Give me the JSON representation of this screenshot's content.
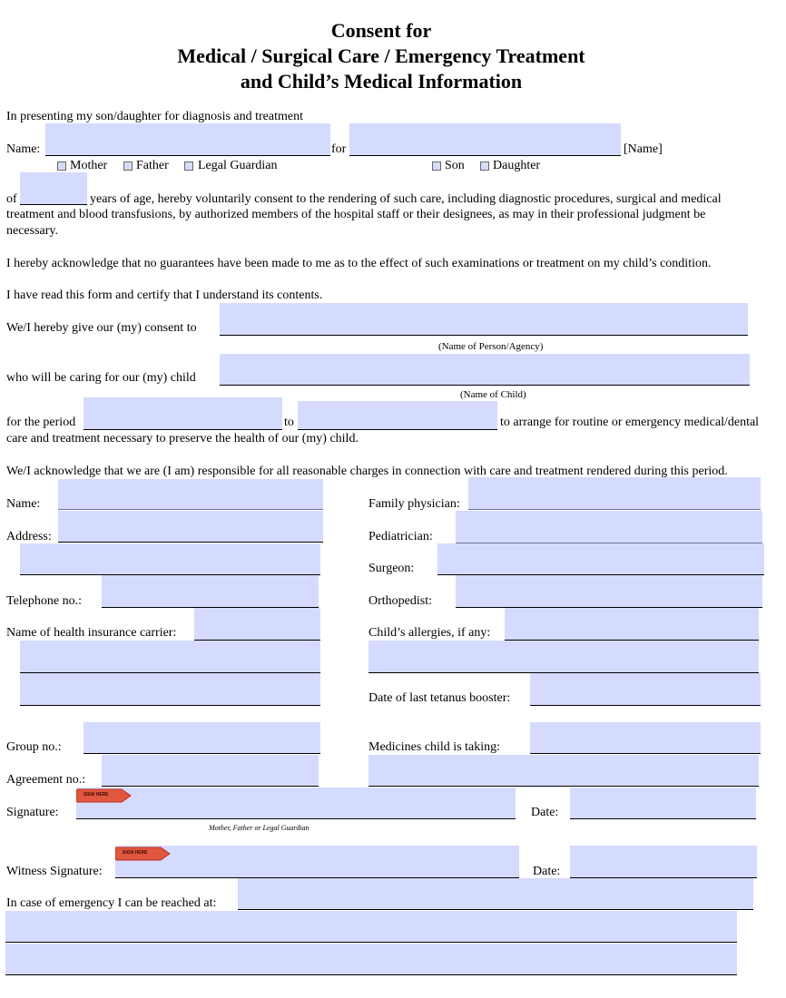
{
  "header": {
    "title_line1": "Consent for",
    "title_line2": "Medical / Surgical Care / Emergency Treatment",
    "title_line3": "and Child’s Medical Information"
  },
  "intro": {
    "presenting_text": "In presenting my son/daughter for diagnosis and treatment",
    "name_label": "Name:",
    "for_label": "for",
    "name_suffix": "[Name]",
    "parent_options": [
      {
        "label": "Mother",
        "checked": false
      },
      {
        "label": "Father",
        "checked": false
      },
      {
        "label": "Legal Guardian",
        "checked": false
      }
    ],
    "child_options": [
      {
        "label": "Son",
        "checked": false
      },
      {
        "label": "Daughter",
        "checked": false
      }
    ],
    "age_prefix": "of",
    "age_text_line1": "years of age, hereby voluntarily consent to the rendering of such care, including diagnostic procedures, surgical and medical",
    "age_text_line2": "treatment and blood transfusions, by authorized members of the hospital staff or their designees, as may in their professional judgment be",
    "age_text_line3": "necessary.",
    "acknowledge_text": "I hereby acknowledge that no guarantees have been made to me as to the effect of such examinations or treatment on my child’s condition.",
    "read_text": "I have read this form and certify that I understand its contents."
  },
  "consent": {
    "consent_to_label": "We/I hereby give our (my) consent to",
    "consent_to_caption": "(Name of Person/Agency)",
    "caring_label": "who will be caring for our (my) child",
    "caring_caption": "(Name of Child)",
    "period_label": "for the period",
    "period_to_label": "to",
    "period_suffix": "to arrange for routine or emergency medical/dental",
    "period_line2": "care and treatment necessary to preserve the health of our (my) child.",
    "responsible_text": "We/I acknowledge that we are (I am) responsible for all reasonable charges in connection with care and treatment rendered during this period."
  },
  "left_fields": {
    "name_label": "Name:",
    "address_label": "Address:",
    "telephone_label": "Telephone no.:",
    "insurance_label": "Name of health insurance carrier:",
    "group_label": "Group no.:",
    "agreement_label": "Agreement no.:"
  },
  "right_fields": {
    "family_physician_label": "Family physician:",
    "pediatrician_label": "Pediatrician:",
    "surgeon_label": "Surgeon:",
    "orthopedist_label": "Orthopedist:",
    "allergies_label": "Child’s allergies, if any:",
    "tetanus_label": "Date of last tetanus booster:",
    "medicines_label": "Medicines child is taking:"
  },
  "signatures": {
    "signature_label": "Signature:",
    "signature_caption": "Mother, Father or Legal Guardian",
    "date_label": "Date:",
    "witness_label": "Witness  Signature:",
    "witness_date_label": "Date:",
    "sign_here_tag": "SIGN HERE",
    "emergency_label": "In case of emergency I can be reached at:"
  },
  "colors": {
    "field_fill": "#d5dbfe",
    "sign_tag": "#e0563e"
  }
}
